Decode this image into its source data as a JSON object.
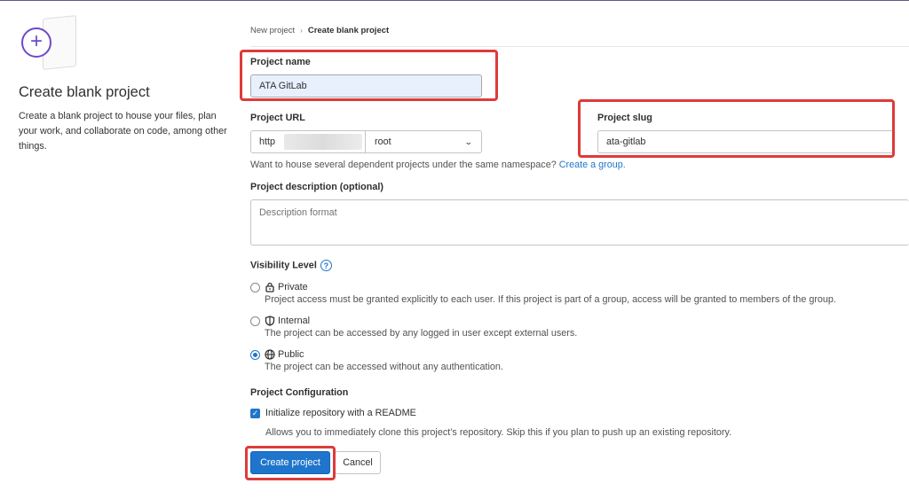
{
  "left": {
    "title": "Create blank project",
    "description": "Create a blank project to house your files, plan your work, and collaborate on code, among other things."
  },
  "breadcrumb": {
    "items": [
      {
        "label": "New project"
      },
      {
        "label": "Create blank project"
      }
    ],
    "separator": "›"
  },
  "form": {
    "project_name": {
      "label": "Project name",
      "value": "ATA GitLab"
    },
    "project_url": {
      "label": "Project URL",
      "prefix": "http",
      "namespace": "root"
    },
    "project_slug": {
      "label": "Project slug",
      "value": "ata-gitlab"
    },
    "namespace_help": "Want to house several dependent projects under the same namespace?",
    "namespace_help_link": "Create a group.",
    "description": {
      "label": "Project description (optional)",
      "placeholder": "Description format"
    },
    "visibility": {
      "label": "Visibility Level",
      "help_icon": "?",
      "options": [
        {
          "title": "Private",
          "icon": "lock-icon",
          "desc": "Project access must be granted explicitly to each user. If this project is part of a group, access will be granted to members of the group.",
          "selected": false
        },
        {
          "title": "Internal",
          "icon": "shield-icon",
          "desc": "The project can be accessed by any logged in user except external users.",
          "selected": false
        },
        {
          "title": "Public",
          "icon": "globe-icon",
          "desc": "The project can be accessed without any authentication.",
          "selected": true
        }
      ]
    },
    "configuration": {
      "label": "Project Configuration",
      "readme_label": "Initialize repository with a README",
      "readme_checked": true,
      "readme_help": "Allows you to immediately clone this project’s repository. Skip this if you plan to push up an existing repository."
    },
    "buttons": {
      "create": "Create project",
      "cancel": "Cancel"
    }
  },
  "colors": {
    "accent": "#1f75cb",
    "highlight": "#dd3b3b",
    "illustration": "#6e49cb"
  }
}
